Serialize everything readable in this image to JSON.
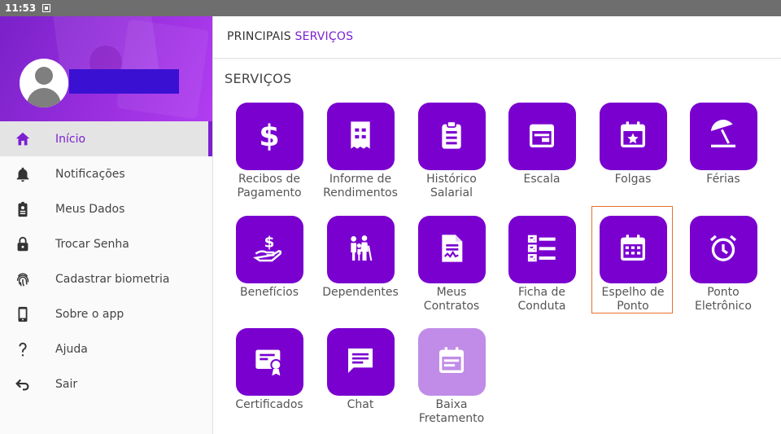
{
  "status_bar": {
    "time": "11:53"
  },
  "drawer": {
    "user_name": "",
    "menu": [
      {
        "label": "Início",
        "icon": "home-icon",
        "active": true
      },
      {
        "label": "Notificações",
        "icon": "bell-icon"
      },
      {
        "label": "Meus Dados",
        "icon": "badge-icon"
      },
      {
        "label": "Trocar Senha",
        "icon": "lock-icon"
      },
      {
        "label": "Cadastrar biometria",
        "icon": "fingerprint-icon"
      },
      {
        "label": "Sobre o app",
        "icon": "phone-icon"
      },
      {
        "label": "Ajuda",
        "icon": "question-icon"
      },
      {
        "label": "Sair",
        "icon": "exit-icon"
      }
    ]
  },
  "header": {
    "title_prefix": "PRINCIPAIS",
    "title_accent": "SERVIÇOS"
  },
  "section_title": "SERVIÇOS",
  "tiles": [
    {
      "label": "Recibos de Pagamento",
      "icon": "dollar-icon"
    },
    {
      "label": "Informe de Rendimentos",
      "icon": "receipt-icon"
    },
    {
      "label": "Histórico Salarial",
      "icon": "clipboard-icon"
    },
    {
      "label": "Escala",
      "icon": "calendar-schedule-icon"
    },
    {
      "label": "Folgas",
      "icon": "calendar-star-icon"
    },
    {
      "label": "Férias",
      "icon": "beach-umbrella-icon"
    },
    {
      "label": "Benefícios",
      "icon": "hand-dollar-icon"
    },
    {
      "label": "Dependentes",
      "icon": "family-icon"
    },
    {
      "label": "Meus Contratos",
      "icon": "contract-icon"
    },
    {
      "label": "Ficha de Conduta",
      "icon": "checklist-icon"
    },
    {
      "label": "Espelho de Ponto",
      "icon": "calendar-grid-icon",
      "highlighted": true
    },
    {
      "label": "Ponto Eletrônico",
      "icon": "alarm-clock-icon"
    },
    {
      "label": "Certificados",
      "icon": "certificate-icon"
    },
    {
      "label": "Chat",
      "icon": "chat-icon"
    },
    {
      "label": "Baixa Fretamento",
      "icon": "calendar-note-icon",
      "disabled": true
    }
  ],
  "colors": {
    "accent": "#7b1fd0",
    "tile": "#7a00d0",
    "tile_disabled": "#c08ce8",
    "highlight": "#e8702a"
  }
}
